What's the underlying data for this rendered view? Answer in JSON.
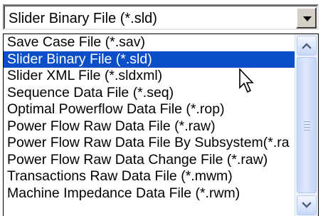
{
  "combo": {
    "selected_value": "Slider Binary File (*.sld)",
    "dropdown_icon": "chevron-down-icon"
  },
  "list": {
    "items": [
      {
        "label": "Save Case File (*.sav)",
        "selected": false
      },
      {
        "label": "Slider Binary File (*.sld)",
        "selected": true
      },
      {
        "label": "Slider XML File (*.sldxml)",
        "selected": false
      },
      {
        "label": "Sequence Data File (*.seq)",
        "selected": false
      },
      {
        "label": "Optimal Powerflow Data File (*.rop)",
        "selected": false
      },
      {
        "label": "Power Flow Raw Data File (*.raw)",
        "selected": false
      },
      {
        "label": "Power Flow Raw Data File By Subsystem(*.ra",
        "selected": false
      },
      {
        "label": "Power Flow Raw Data Change File (*.raw)",
        "selected": false
      },
      {
        "label": "Transactions Raw Data File (*.mwm)",
        "selected": false
      },
      {
        "label": "Machine Impedance Data File (*.rwm)",
        "selected": false
      }
    ]
  },
  "scrollbar": {
    "up_icon": "chevron-up-icon",
    "down_icon": "chevron-down-icon",
    "position": 0
  },
  "colors": {
    "selection": "#0a4fc7",
    "selection_text": "#ffffff"
  },
  "cursor": {
    "icon": "arrow-cursor-icon"
  }
}
